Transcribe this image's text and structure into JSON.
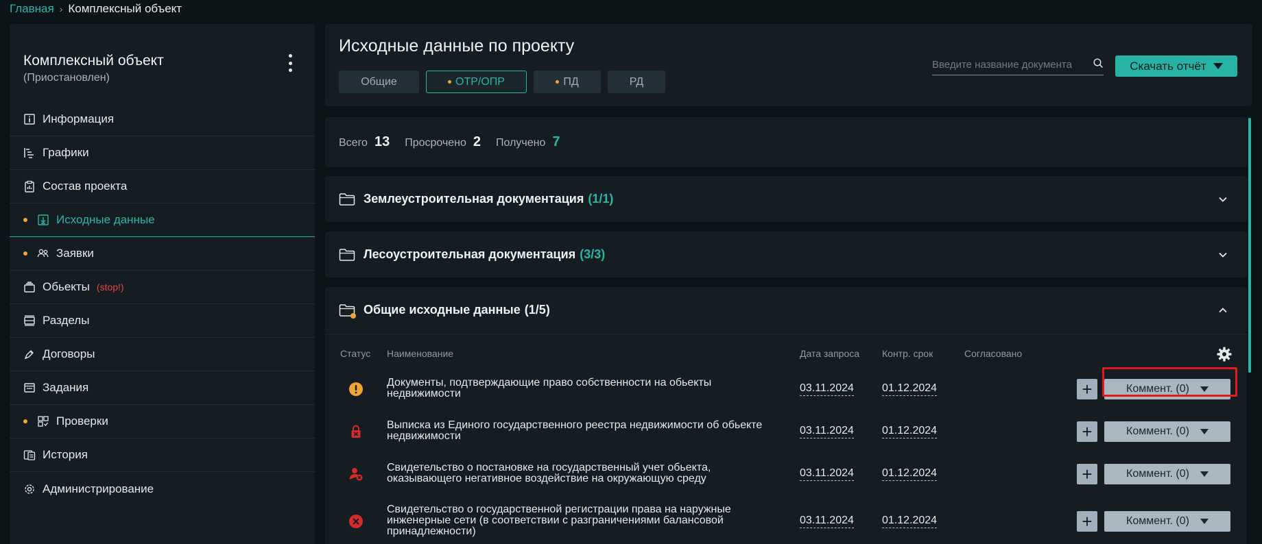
{
  "breadcrumb": {
    "home": "Главная",
    "current": "Комплексный объект"
  },
  "sidebar": {
    "title": "Комплексный объект",
    "status": "(Приостановлен)",
    "items": [
      {
        "label": "Информация",
        "icon": "info-icon",
        "dot": false,
        "active": false
      },
      {
        "label": "Графики",
        "icon": "gantt-icon",
        "dot": false,
        "active": false
      },
      {
        "label": "Состав проекта",
        "icon": "clipboard-chart-icon",
        "dot": false,
        "active": false
      },
      {
        "label": "Исходные данные",
        "icon": "download-box-icon",
        "dot": true,
        "active": true
      },
      {
        "label": "Заявки",
        "icon": "users-icon",
        "dot": true,
        "active": false
      },
      {
        "label": "Обьекты",
        "icon": "layers-icon",
        "dot": false,
        "active": false,
        "badge": "(stop!)"
      },
      {
        "label": "Разделы",
        "icon": "sections-icon",
        "dot": false,
        "active": false
      },
      {
        "label": "Договоры",
        "icon": "pen-icon",
        "dot": false,
        "active": false
      },
      {
        "label": "Задания",
        "icon": "tasks-icon",
        "dot": false,
        "active": false
      },
      {
        "label": "Проверки",
        "icon": "grid-check-icon",
        "dot": true,
        "active": false
      },
      {
        "label": "История",
        "icon": "history-icon",
        "dot": false,
        "active": false
      },
      {
        "label": "Администрирование",
        "icon": "gear-icon",
        "dot": false,
        "active": false
      }
    ]
  },
  "header": {
    "title": "Исходные данные по проекту",
    "tabs": [
      {
        "label": "Общие",
        "dot": false,
        "active": false
      },
      {
        "label": "ОТР/ОПР",
        "dot": true,
        "active": true
      },
      {
        "label": "ПД",
        "dot": true,
        "active": false
      },
      {
        "label": "РД",
        "dot": false,
        "active": false
      }
    ],
    "search_placeholder": "Введите название документа",
    "download_label": "Скачать отчёт"
  },
  "stats": {
    "total_label": "Всего",
    "total": "13",
    "overdue_label": "Просрочено",
    "overdue": "2",
    "received_label": "Получено",
    "received": "7"
  },
  "folders": [
    {
      "title": "Землеустроительная документация",
      "count": "(1/1)",
      "expanded": false
    },
    {
      "title": "Лесоустроительная документация",
      "count": "(3/3)",
      "expanded": false
    },
    {
      "title": "Общие исходные данные",
      "count": "(1/5)",
      "expanded": true
    }
  ],
  "table": {
    "columns": {
      "status": "Статус",
      "name": "Наименование",
      "request_date": "Дата запроса",
      "deadline": "Контр. срок",
      "approved": "Согласовано"
    },
    "rows": [
      {
        "status_icon": "warning-circle-icon",
        "name": "Документы, подтверждающие право собственности на обьекты недвижимости",
        "request_date": "03.11.2024",
        "deadline": "01.12.2024",
        "comment": "Коммент. (0)"
      },
      {
        "status_icon": "lock-x-icon",
        "name": "Выписка из Единого государственного реестра недвижимости об обьекте недвижимости",
        "request_date": "03.11.2024",
        "deadline": "01.12.2024",
        "comment": "Коммент. (0)"
      },
      {
        "status_icon": "user-x-icon",
        "name": "Свидетельство о постановке на государственный учет обьекта, оказывающего негативное воздействие на окружающую среду",
        "request_date": "03.11.2024",
        "deadline": "01.12.2024",
        "comment": "Коммент. (0)"
      },
      {
        "status_icon": "x-circle-icon",
        "name": "Свидетельство о государственной регистрации права на наружные инженерные сети (в соответствии с разграничениями балансовой принадлежности)",
        "request_date": "03.11.2024",
        "deadline": "01.12.2024",
        "comment": "Коммент. (0)"
      }
    ]
  },
  "colors": {
    "accent": "#2bb5a6",
    "warning": "#f0a43a",
    "danger": "#e64545",
    "highlight": "#e11b1b"
  }
}
